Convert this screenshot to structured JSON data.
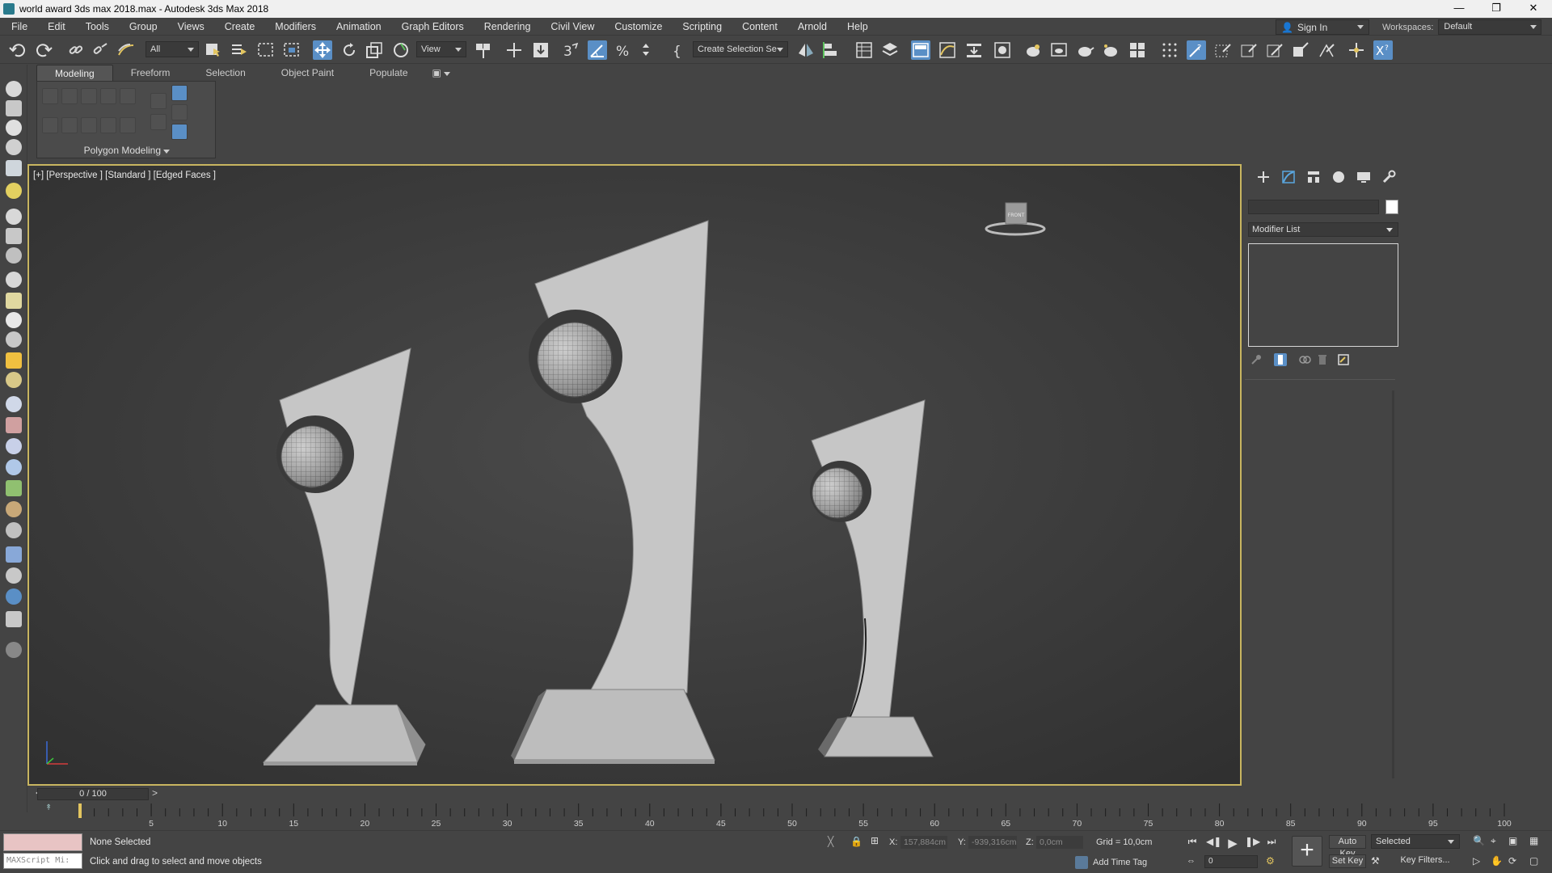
{
  "window": {
    "title": "world award 3ds max 2018.max - Autodesk 3ds Max 2018",
    "controls": [
      "—",
      "❐",
      "✕"
    ]
  },
  "menu": [
    "File",
    "Edit",
    "Tools",
    "Group",
    "Views",
    "Create",
    "Modifiers",
    "Animation",
    "Graph Editors",
    "Rendering",
    "Civil View",
    "Customize",
    "Scripting",
    "Content",
    "Arnold",
    "Help"
  ],
  "account": {
    "sign_in": "Sign In",
    "workspaces_label": "Workspaces:",
    "workspace": "Default"
  },
  "toolbar": {
    "filter_value": "All",
    "refcoord_value": "View",
    "selection_set_placeholder": "Create Selection Se"
  },
  "ribbon": {
    "tabs": [
      "Modeling",
      "Freeform",
      "Selection",
      "Object Paint",
      "Populate"
    ],
    "active_tab": "Modeling",
    "panel_label": "Polygon Modeling"
  },
  "viewport": {
    "label": "[+] [Perspective ] [Standard ] [Edged Faces ]",
    "viewcube_face": "FRONT"
  },
  "command_panel": {
    "modifier_list": "Modifier List",
    "object_color": "#ffffff"
  },
  "timeline": {
    "frame_readout": "0 / 100",
    "ticks": [
      "5",
      "10",
      "15",
      "20",
      "25",
      "30",
      "35",
      "40",
      "45",
      "50",
      "55",
      "60",
      "65",
      "70",
      "75",
      "80",
      "85",
      "90",
      "95",
      "100"
    ]
  },
  "status": {
    "maxscript": "MAXScript Mi:",
    "selection": "None Selected",
    "prompt": "Click and drag to select and move objects",
    "x_label": "X:",
    "x_value": "157,884cm",
    "y_label": "Y:",
    "y_value": "-939,316cm",
    "z_label": "Z:",
    "z_value": "0,0cm",
    "grid": "Grid = 10,0cm",
    "add_time_tag": "Add Time Tag",
    "current_frame": "0",
    "auto_key": "Auto Key",
    "set_key": "Set Key",
    "selected_value": "Selected",
    "key_filters": "Key Filters..."
  }
}
